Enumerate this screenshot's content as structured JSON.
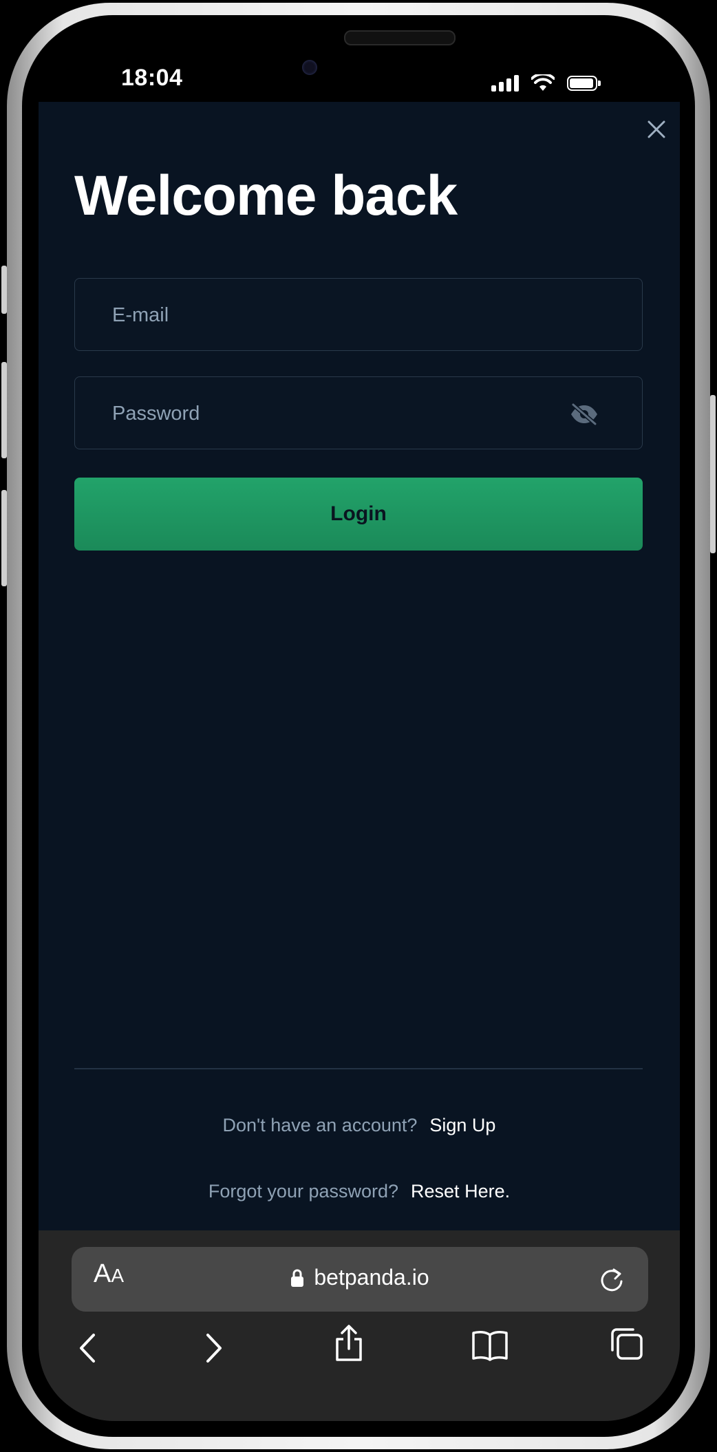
{
  "status_bar": {
    "time": "18:04"
  },
  "login": {
    "title": "Welcome back",
    "email_placeholder": "E-mail",
    "password_placeholder": "Password",
    "login_label": "Login",
    "no_account_text": "Don't have an account?",
    "signup_label": "Sign Up",
    "forgot_text": "Forgot your password?",
    "reset_label": "Reset Here."
  },
  "browser": {
    "aa_big": "A",
    "aa_small": "A",
    "url": "betpanda.io"
  },
  "colors": {
    "background": "#091422",
    "accent_green": "#1f9a64",
    "muted_text": "#8fa2b5"
  },
  "icons": [
    "close-icon",
    "eye-slash-icon",
    "lock-icon",
    "reload-icon",
    "back-icon",
    "forward-icon",
    "share-icon",
    "bookmarks-icon",
    "tabs-icon",
    "signal-icon",
    "wifi-icon",
    "battery-icon"
  ]
}
